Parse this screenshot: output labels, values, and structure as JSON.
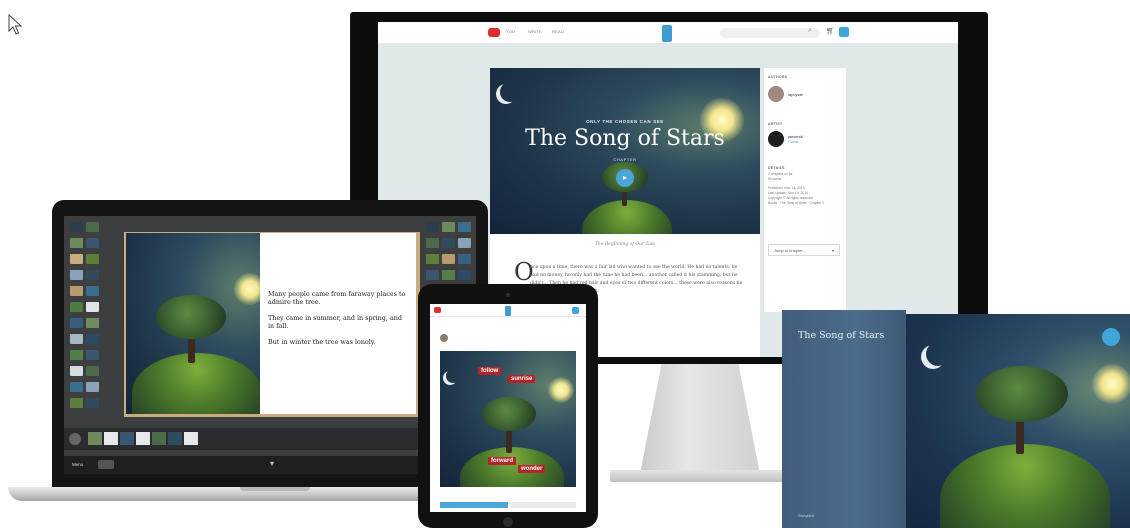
{
  "monitor": {
    "nav": [
      "YOU",
      "WRITE",
      "READ"
    ],
    "cover_kicker": "ONLY THE CHOSEN CAN SEE",
    "title": "The Song of Stars",
    "chapter_label": "CHAPTER",
    "sidebar": {
      "authors_label": "AUTHORS",
      "author_name": "lapoyste",
      "artist_label": "ARTIST",
      "artist_name": "jamiemk",
      "artist_action": "Follow",
      "details_label": "DETAILS",
      "details_lines": [
        "2 chapters so far",
        "60 words",
        "Published: Nov. 14, 2014",
        "Last Update: Nov. 14, 2014",
        "Copyright © All rights reserved",
        "Books · The Song of Stars · Chapter 1"
      ],
      "jump_label": "Jump to chapter…"
    },
    "subtitle": "The Beginning of Our Tale",
    "dropcap": "O",
    "paragraph": "nce upon a time, there was a fair lad who wanted to see the world. He had no talents; he had no money, he only had the tune he had been... another called it his stamming, but he didn't... Then he had red hair and eyes of two different colors... these were also reasons he felt different from... his birth."
  },
  "laptop": {
    "page_text": [
      "Many people came from faraway places to admire the tree.",
      "They came in summer, and in spring, and in fall.",
      "But in winter the tree was lonely."
    ],
    "menu_label": "Menu"
  },
  "tablet": {
    "words": [
      "follow",
      "sunrise",
      "forward",
      "wonder"
    ]
  },
  "hardcover": {
    "title": "The Song of Stars",
    "author": "Storybird"
  },
  "colors": {
    "accent": "#3fa6d9",
    "logo_red": "#e02d2d",
    "word_red": "#b2242a",
    "book_blue": "#4c6c8c"
  },
  "icons": [
    "cursor-arrow-icon",
    "search-icon",
    "cart-icon",
    "notification-icon",
    "play-icon",
    "chevron-down-icon",
    "bird-badge-icon"
  ]
}
